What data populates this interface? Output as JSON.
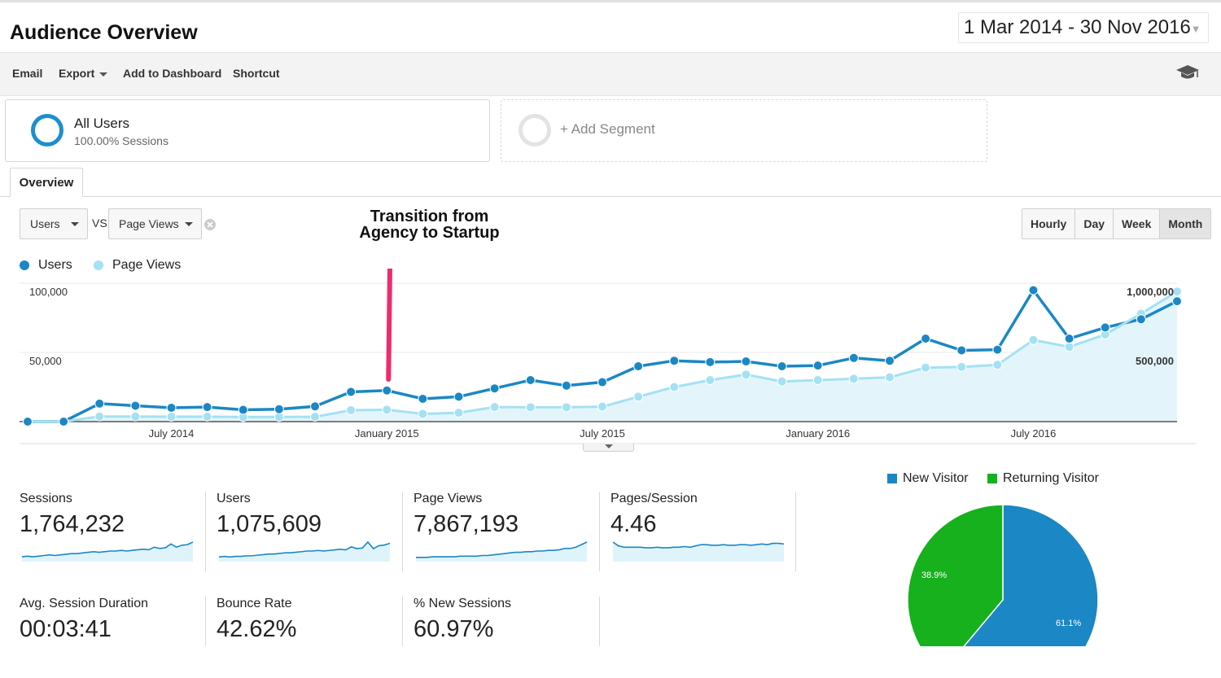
{
  "header": {
    "title": "Audience Overview",
    "date_range": "1 Mar 2014 - 30 Nov 2016"
  },
  "toolbar": {
    "email": "Email",
    "export": "Export",
    "add_to_dashboard": "Add to Dashboard",
    "shortcut": "Shortcut"
  },
  "segments": {
    "active_name": "All Users",
    "active_sub": "100.00% Sessions",
    "add_label": "+ Add Segment"
  },
  "tab": {
    "overview": "Overview"
  },
  "controls": {
    "metric1": "Users",
    "vs": "VS",
    "metric2": "Page Views",
    "buttons": [
      "Hourly",
      "Day",
      "Week",
      "Month"
    ],
    "active_button": "Month"
  },
  "annotation": {
    "line1": "Transition from",
    "line2": "Agency to Startup"
  },
  "chart_data": {
    "type": "line",
    "title": "",
    "x": [
      "2014-03",
      "2014-04",
      "2014-05",
      "2014-06",
      "2014-07",
      "2014-08",
      "2014-09",
      "2014-10",
      "2014-11",
      "2014-12",
      "2015-01",
      "2015-02",
      "2015-03",
      "2015-04",
      "2015-05",
      "2015-06",
      "2015-07",
      "2015-08",
      "2015-09",
      "2015-10",
      "2015-11",
      "2015-12",
      "2016-01",
      "2016-02",
      "2016-03",
      "2016-04",
      "2016-05",
      "2016-06",
      "2016-07",
      "2016-08",
      "2016-09",
      "2016-10",
      "2016-11"
    ],
    "x_tick_labels": [
      "July 2014",
      "January 2015",
      "July 2015",
      "January 2016",
      "July 2016"
    ],
    "series": [
      {
        "name": "Users",
        "axis": "left",
        "color": "#1b87c4",
        "values": [
          0,
          0,
          13000,
          11500,
          10000,
          10500,
          8500,
          9000,
          11000,
          21500,
          22500,
          16500,
          18000,
          24000,
          30000,
          26000,
          28500,
          40000,
          44000,
          43000,
          43500,
          40000,
          40500,
          46000,
          44000,
          60000,
          51500,
          52000,
          95000,
          60000,
          68000,
          74000,
          87000
        ]
      },
      {
        "name": "Page Views",
        "axis": "right",
        "color": "#93dbf0",
        "values": [
          0,
          0,
          37000,
          37000,
          35000,
          36000,
          33000,
          34000,
          35000,
          82000,
          86000,
          56000,
          64000,
          105000,
          104000,
          104000,
          108000,
          180000,
          250000,
          300000,
          340000,
          290000,
          300000,
          310000,
          320000,
          390000,
          395000,
          410000,
          590000,
          540000,
          630000,
          780000,
          940000
        ]
      }
    ],
    "y_left": {
      "ticks": [
        "100,000",
        "50,000"
      ],
      "max": 100000
    },
    "y_right": {
      "ticks": [
        "1,000,000",
        "500,000"
      ],
      "max": 1000000
    },
    "annotation_month": "2015-01"
  },
  "metrics": [
    {
      "label": "Sessions",
      "value": "1,764,232",
      "spark": [
        5,
        6,
        5,
        6,
        7,
        8,
        7,
        8,
        9,
        10,
        10,
        11,
        12,
        13,
        12,
        13,
        14,
        14,
        15,
        14,
        15,
        16,
        17,
        16,
        20,
        18,
        19,
        25,
        20,
        23,
        24,
        28
      ]
    },
    {
      "label": "Users",
      "value": "1,075,609",
      "spark": [
        5,
        6,
        5,
        6,
        6,
        7,
        7,
        8,
        9,
        10,
        10,
        11,
        12,
        12,
        13,
        14,
        15,
        15,
        16,
        15,
        16,
        17,
        18,
        17,
        22,
        19,
        20,
        30,
        19,
        24,
        25,
        28
      ]
    },
    {
      "label": "Page Views",
      "value": "7,867,193",
      "spark": [
        4,
        4,
        4,
        5,
        5,
        5,
        5,
        5,
        6,
        6,
        6,
        6,
        7,
        7,
        8,
        9,
        10,
        11,
        12,
        12,
        13,
        13,
        14,
        14,
        15,
        15,
        16,
        18,
        18,
        20,
        24,
        28
      ]
    },
    {
      "label": "Pages/Session",
      "value": "4.46",
      "spark": [
        28,
        22,
        20,
        20,
        20,
        20,
        19,
        19,
        20,
        19,
        19,
        20,
        20,
        21,
        20,
        22,
        24,
        24,
        23,
        23,
        24,
        23,
        23,
        24,
        24,
        23,
        24,
        25,
        24,
        26,
        26,
        25
      ]
    },
    {
      "label": "Avg. Session Duration",
      "value": "00:03:41"
    },
    {
      "label": "Bounce Rate",
      "value": "42.62%"
    },
    {
      "label": "% New Sessions",
      "value": "60.97%"
    }
  ],
  "pie": {
    "legend": [
      {
        "label": "New Visitor",
        "color": "#1b87c4"
      },
      {
        "label": "Returning Visitor",
        "color": "#16b11d"
      }
    ],
    "slices": [
      {
        "label": "New Visitor",
        "value": 61.1,
        "text": "61.1%",
        "color": "#1b87c4"
      },
      {
        "label": "Returning Visitor",
        "value": 38.9,
        "text": "38.9%",
        "color": "#16b11d"
      }
    ]
  },
  "colors": {
    "accent": "#1b87c4",
    "accent_light": "#93dbf0",
    "fill": "#e3f5fb",
    "annotation": "#ee2b6c",
    "returning": "#16b11d"
  }
}
